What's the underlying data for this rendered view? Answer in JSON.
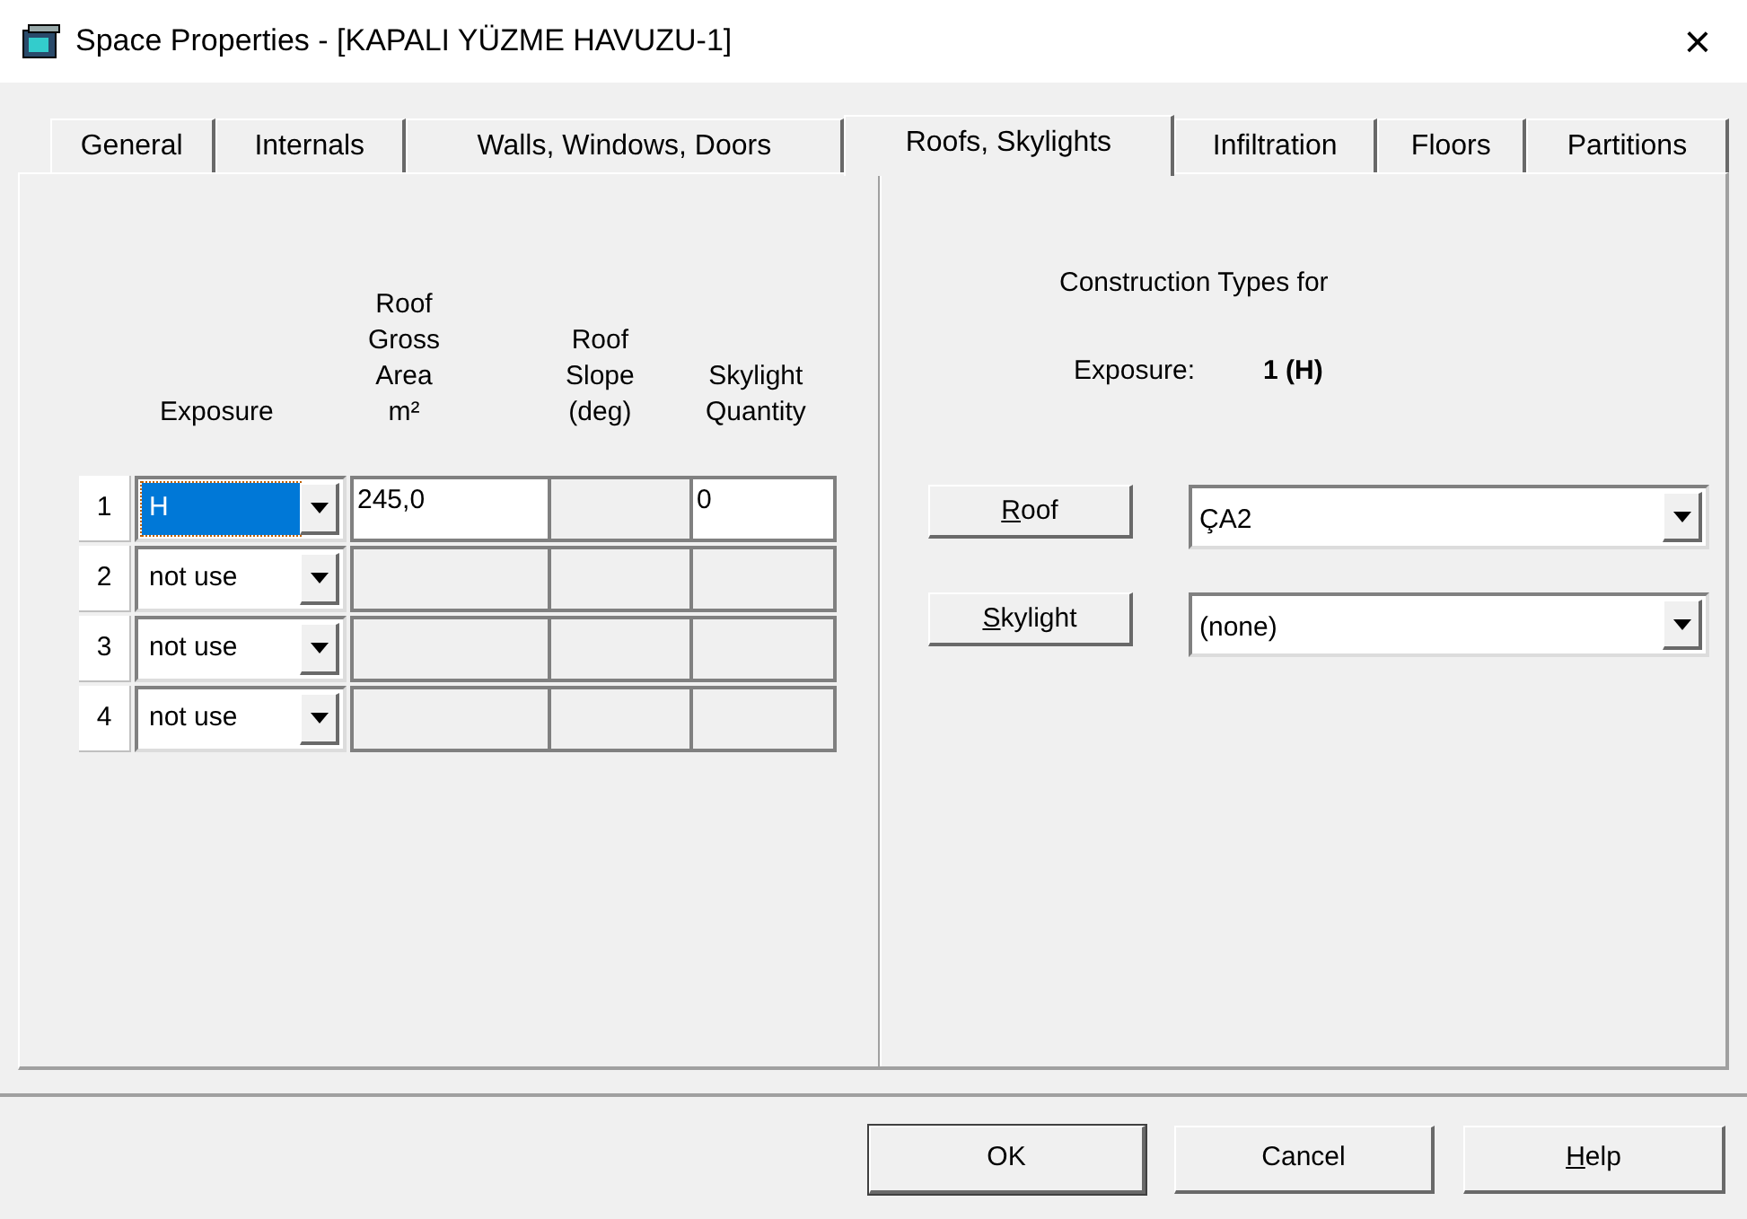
{
  "window": {
    "title": "Space Properties - [KAPALI YÜZME HAVUZU-1]",
    "close": "×"
  },
  "tabs": [
    {
      "label": "General",
      "selected": false
    },
    {
      "label": "Internals",
      "selected": false
    },
    {
      "label": "Walls, Windows, Doors",
      "selected": false
    },
    {
      "label": "Roofs, Skylights",
      "selected": true
    },
    {
      "label": "Infiltration",
      "selected": false
    },
    {
      "label": "Floors",
      "selected": false
    },
    {
      "label": "Partitions",
      "selected": false
    }
  ],
  "grid": {
    "columns": [
      [
        "Exposure"
      ],
      [
        "Roof",
        "Gross",
        "Area",
        "m²"
      ],
      [
        "Roof",
        "Slope",
        "(deg)"
      ],
      [
        "Skylight",
        "Quantity"
      ]
    ],
    "rows": [
      {
        "number": "1",
        "exposure": "H",
        "selected": true,
        "editable": true,
        "area": "245,0",
        "quantity": "0"
      },
      {
        "number": "2",
        "exposure": "not use",
        "selected": false,
        "editable": false
      },
      {
        "number": "3",
        "exposure": "not use",
        "selected": false,
        "editable": false
      },
      {
        "number": "4",
        "exposure": "not use",
        "selected": false,
        "editable": false
      }
    ]
  },
  "construction": {
    "heading": "Construction Types for",
    "exposure_label": "Exposure:",
    "exposure_value": "1 (H)",
    "types": [
      {
        "hotkey": "R",
        "rest": "oof",
        "value": "ÇA2"
      },
      {
        "hotkey": "S",
        "rest": "kylight",
        "value": "(none)"
      }
    ]
  },
  "buttons": [
    {
      "rest": "OK",
      "default": true
    },
    {
      "rest": "Cancel",
      "default": false
    },
    {
      "hotkey": "H",
      "rest": "elp",
      "default": false
    }
  ]
}
